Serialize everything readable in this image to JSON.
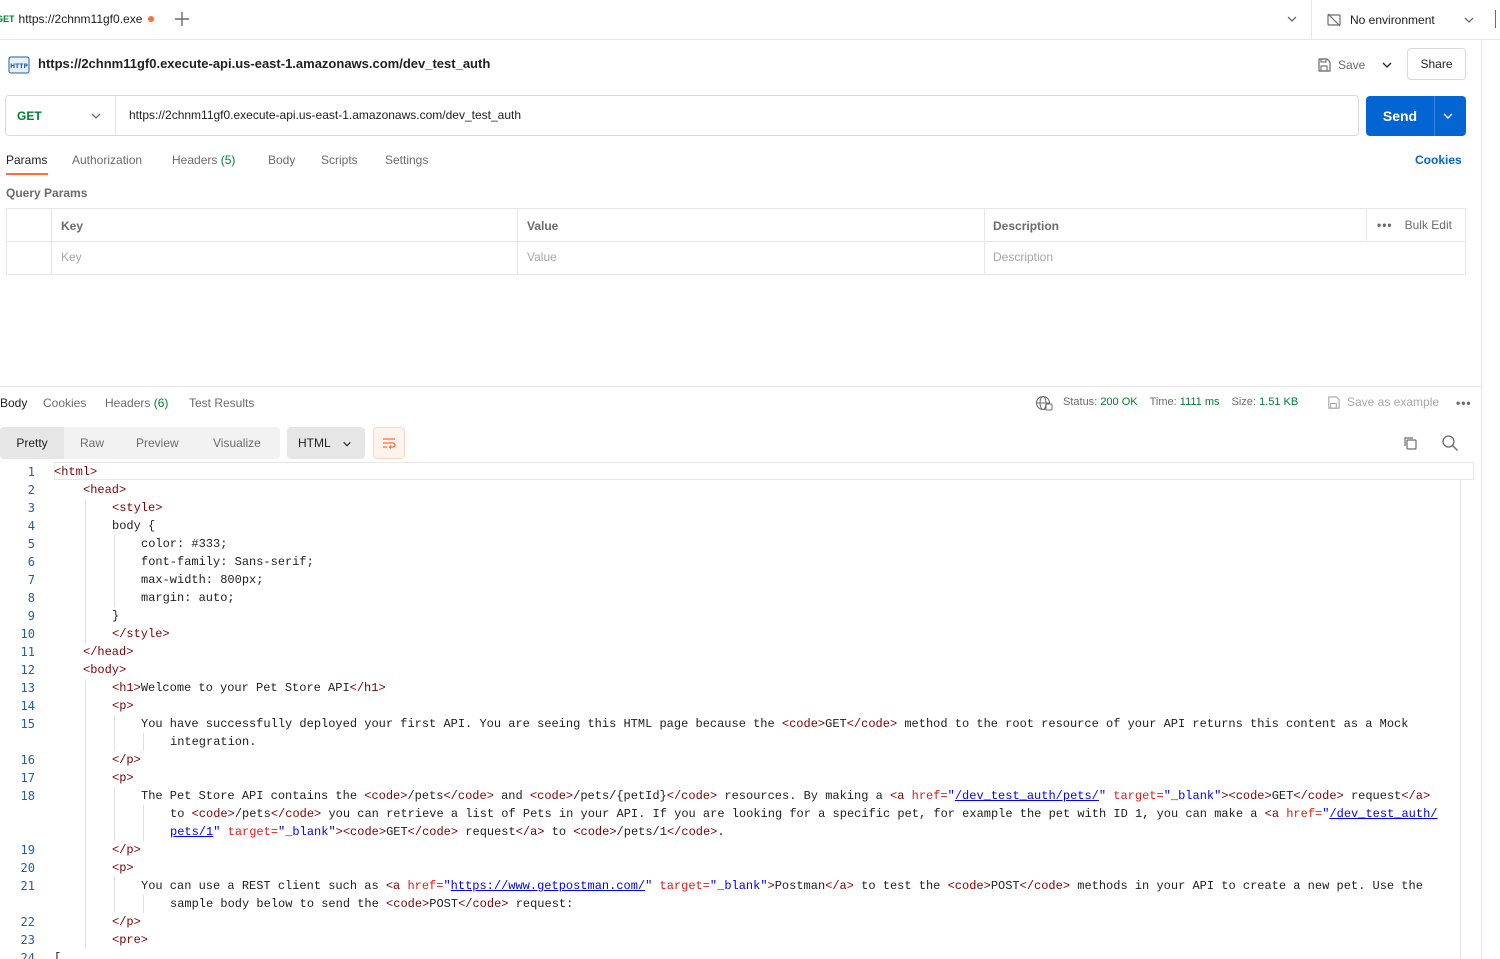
{
  "tab": {
    "method": "GET",
    "title": "https://2chnm11gf0.exe"
  },
  "environment": {
    "label": "No environment"
  },
  "request": {
    "title": "https://2chnm11gf0.execute-api.us-east-1.amazonaws.com/dev_test_auth",
    "save_label": "Save",
    "share_label": "Share",
    "method": "GET",
    "url": "https://2chnm11gf0.execute-api.us-east-1.amazonaws.com/dev_test_auth",
    "send_label": "Send"
  },
  "request_tabs": {
    "params": "Params",
    "authorization": "Authorization",
    "headers": "Headers",
    "headers_count": "(5)",
    "body": "Body",
    "scripts": "Scripts",
    "settings": "Settings",
    "cookies": "Cookies"
  },
  "query_params": {
    "label": "Query Params",
    "columns": {
      "key": "Key",
      "value": "Value",
      "description": "Description"
    },
    "bulk_edit": "Bulk Edit",
    "placeholders": {
      "key": "Key",
      "value": "Value",
      "description": "Description"
    }
  },
  "response": {
    "tabs": {
      "body": "Body",
      "cookies": "Cookies",
      "headers": "Headers",
      "headers_count": "(6)",
      "test_results": "Test Results"
    },
    "status_label": "Status:",
    "status_value": "200 OK",
    "time_label": "Time:",
    "time_value": "1111 ms",
    "size_label": "Size:",
    "size_value": "1.51 KB",
    "save_example": "Save as example",
    "formats": {
      "pretty": "Pretty",
      "raw": "Raw",
      "preview": "Preview",
      "visualize": "Visualize"
    },
    "language": "HTML"
  },
  "code_lines": [
    {
      "n": "1",
      "parts": [
        [
          "tag",
          "<html>"
        ]
      ],
      "indent": 0
    },
    {
      "n": "2",
      "parts": [
        [
          "tag",
          "<head>"
        ]
      ],
      "indent": 1
    },
    {
      "n": "3",
      "parts": [
        [
          "tag",
          "<style>"
        ]
      ],
      "indent": 2
    },
    {
      "n": "4",
      "parts": [
        [
          "txt",
          "body {"
        ]
      ],
      "indent": 2
    },
    {
      "n": "5",
      "parts": [
        [
          "txt",
          "color: #333;"
        ]
      ],
      "indent": 3
    },
    {
      "n": "6",
      "parts": [
        [
          "txt",
          "font-family: Sans-serif;"
        ]
      ],
      "indent": 3
    },
    {
      "n": "7",
      "parts": [
        [
          "txt",
          "max-width: 800px;"
        ]
      ],
      "indent": 3
    },
    {
      "n": "8",
      "parts": [
        [
          "txt",
          "margin: auto;"
        ]
      ],
      "indent": 3
    },
    {
      "n": "9",
      "parts": [
        [
          "txt",
          "}"
        ]
      ],
      "indent": 2
    },
    {
      "n": "10",
      "parts": [
        [
          "tag",
          "</style>"
        ]
      ],
      "indent": 2
    },
    {
      "n": "11",
      "parts": [
        [
          "tag",
          "</head>"
        ]
      ],
      "indent": 1
    },
    {
      "n": "12",
      "parts": [
        [
          "tag",
          "<body>"
        ]
      ],
      "indent": 1
    },
    {
      "n": "13",
      "parts": [
        [
          "tag",
          "<h1>"
        ],
        [
          "txt",
          "Welcome to your Pet Store API"
        ],
        [
          "tag",
          "</h1>"
        ]
      ],
      "indent": 2
    },
    {
      "n": "14",
      "parts": [
        [
          "tag",
          "<p>"
        ]
      ],
      "indent": 2
    },
    {
      "n": "15",
      "parts": [
        [
          "txt",
          "You have successfully deployed your first API. You are seeing this HTML page because the "
        ],
        [
          "tag",
          "<code>"
        ],
        [
          "txt",
          "GET"
        ],
        [
          "tag",
          "</code>"
        ],
        [
          "txt",
          " method to the root resource of your API returns this content as a Mock"
        ]
      ],
      "indent": 3
    },
    {
      "n": "",
      "parts": [
        [
          "txt",
          "integration."
        ]
      ],
      "indent": 4
    },
    {
      "n": "16",
      "parts": [
        [
          "tag",
          "</p>"
        ]
      ],
      "indent": 2
    },
    {
      "n": "17",
      "parts": [
        [
          "tag",
          "<p>"
        ]
      ],
      "indent": 2
    },
    {
      "n": "18",
      "parts": [
        [
          "txt",
          "The Pet Store API contains the "
        ],
        [
          "tag",
          "<code>"
        ],
        [
          "txt",
          "/pets"
        ],
        [
          "tag",
          "</code>"
        ],
        [
          "txt",
          " and "
        ],
        [
          "tag",
          "<code>"
        ],
        [
          "txt",
          "/pets/{petId}"
        ],
        [
          "tag",
          "</code>"
        ],
        [
          "txt",
          " resources. By making a "
        ],
        [
          "tag",
          "<a "
        ],
        [
          "attr",
          "href="
        ],
        [
          "str",
          "\""
        ],
        [
          "lnk",
          "/dev_test_auth/pets/"
        ],
        [
          "str",
          "\""
        ],
        [
          "attr",
          " target="
        ],
        [
          "str",
          "\"_blank\""
        ],
        [
          "tag",
          ">"
        ],
        [
          "tag",
          "<code>"
        ],
        [
          "txt",
          "GET"
        ],
        [
          "tag",
          "</code>"
        ],
        [
          "txt",
          " request"
        ],
        [
          "tag",
          "</a>"
        ]
      ],
      "indent": 3
    },
    {
      "n": "",
      "parts": [
        [
          "txt",
          "to "
        ],
        [
          "tag",
          "<code>"
        ],
        [
          "txt",
          "/pets"
        ],
        [
          "tag",
          "</code>"
        ],
        [
          "txt",
          " you can retrieve a list of Pets in your API. If you are looking for a specific pet, for example the pet with ID 1, you can make a "
        ],
        [
          "tag",
          "<a "
        ],
        [
          "attr",
          "href="
        ],
        [
          "str",
          "\""
        ],
        [
          "lnk",
          "/dev_test_auth/"
        ]
      ],
      "indent": 4
    },
    {
      "n": "",
      "parts": [
        [
          "lnk",
          "pets/1"
        ],
        [
          "str",
          "\""
        ],
        [
          "attr",
          " target="
        ],
        [
          "str",
          "\"_blank\""
        ],
        [
          "tag",
          ">"
        ],
        [
          "tag",
          "<code>"
        ],
        [
          "txt",
          "GET"
        ],
        [
          "tag",
          "</code>"
        ],
        [
          "txt",
          " request"
        ],
        [
          "tag",
          "</a>"
        ],
        [
          "txt",
          " to "
        ],
        [
          "tag",
          "<code>"
        ],
        [
          "txt",
          "/pets/1"
        ],
        [
          "tag",
          "</code>"
        ],
        [
          "txt",
          "."
        ]
      ],
      "indent": 4
    },
    {
      "n": "19",
      "parts": [
        [
          "tag",
          "</p>"
        ]
      ],
      "indent": 2
    },
    {
      "n": "20",
      "parts": [
        [
          "tag",
          "<p>"
        ]
      ],
      "indent": 2
    },
    {
      "n": "21",
      "parts": [
        [
          "txt",
          "You can use a REST client such as "
        ],
        [
          "tag",
          "<a "
        ],
        [
          "attr",
          "href="
        ],
        [
          "str",
          "\""
        ],
        [
          "lnk",
          "https://www.getpostman.com/"
        ],
        [
          "str",
          "\""
        ],
        [
          "attr",
          " target="
        ],
        [
          "str",
          "\"_blank\""
        ],
        [
          "tag",
          ">"
        ],
        [
          "txt",
          "Postman"
        ],
        [
          "tag",
          "</a>"
        ],
        [
          "txt",
          " to test the "
        ],
        [
          "tag",
          "<code>"
        ],
        [
          "txt",
          "POST"
        ],
        [
          "tag",
          "</code>"
        ],
        [
          "txt",
          " methods in your API to create a new pet. Use the"
        ]
      ],
      "indent": 3
    },
    {
      "n": "",
      "parts": [
        [
          "txt",
          "sample body below to send the "
        ],
        [
          "tag",
          "<code>"
        ],
        [
          "txt",
          "POST"
        ],
        [
          "tag",
          "</code>"
        ],
        [
          "txt",
          " request:"
        ]
      ],
      "indent": 4
    },
    {
      "n": "22",
      "parts": [
        [
          "tag",
          "</p>"
        ]
      ],
      "indent": 2
    },
    {
      "n": "23",
      "parts": [
        [
          "tag",
          "<pre>"
        ]
      ],
      "indent": 2
    },
    {
      "n": "24",
      "parts": [
        [
          "txt",
          "["
        ]
      ],
      "indent": 0
    }
  ]
}
